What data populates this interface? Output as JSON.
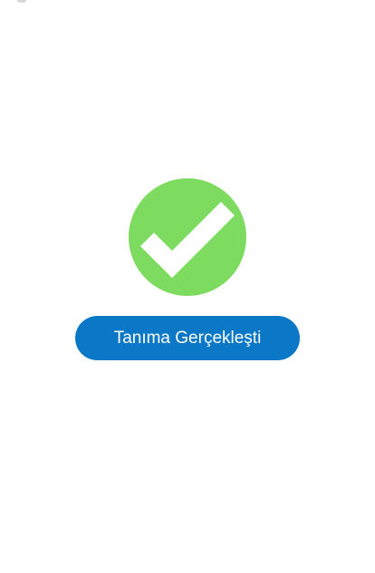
{
  "screen": {
    "result_label": "Tanıma Gerçekleşti"
  },
  "icon": {
    "name": "check-circle-icon"
  },
  "colors": {
    "success_circle": "#7ddc5f",
    "check_mark": "#ffffff",
    "button_background": "#0b78c7",
    "button_text": "#ffffff",
    "page_background": "#ffffff"
  }
}
